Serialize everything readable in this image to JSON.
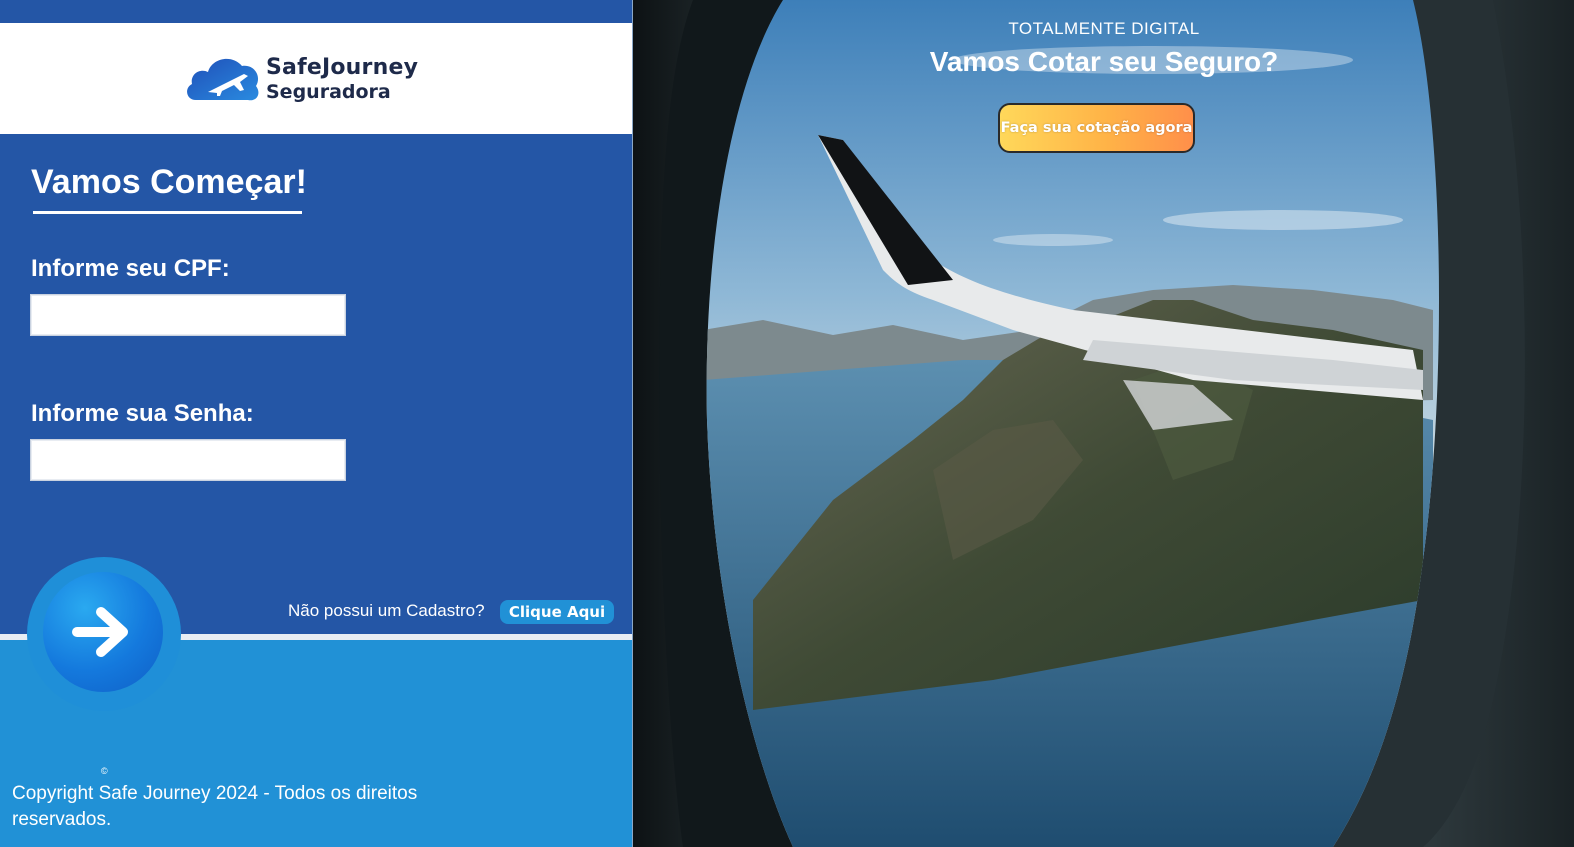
{
  "brand": {
    "name": "SafeJourney",
    "subtitle": "Seguradora"
  },
  "login": {
    "heading": "Vamos Começar!",
    "cpf_label": "Informe seu CPF:",
    "cpf_value": "",
    "senha_label": "Informe sua Senha:",
    "senha_value": "",
    "submit_icon": "arrow-right-icon",
    "no_account_text": "Não possui um Cadastro?",
    "signup_label": "Clique Aqui"
  },
  "footer": {
    "copyright_symbol": "©",
    "copyright_text": "Copyright   Safe Journey 2024 - Todos os direitos reservados."
  },
  "hero": {
    "tagline": "TOTALMENTE DIGITAL",
    "title": "Vamos Cotar seu Seguro?",
    "cta_label": "Faça sua cotação agora"
  },
  "colors": {
    "panel_blue": "#2456a6",
    "light_blue": "#2191d6",
    "cta_gradient_start": "#ffd85a",
    "cta_gradient_end": "#ff8f4a"
  }
}
